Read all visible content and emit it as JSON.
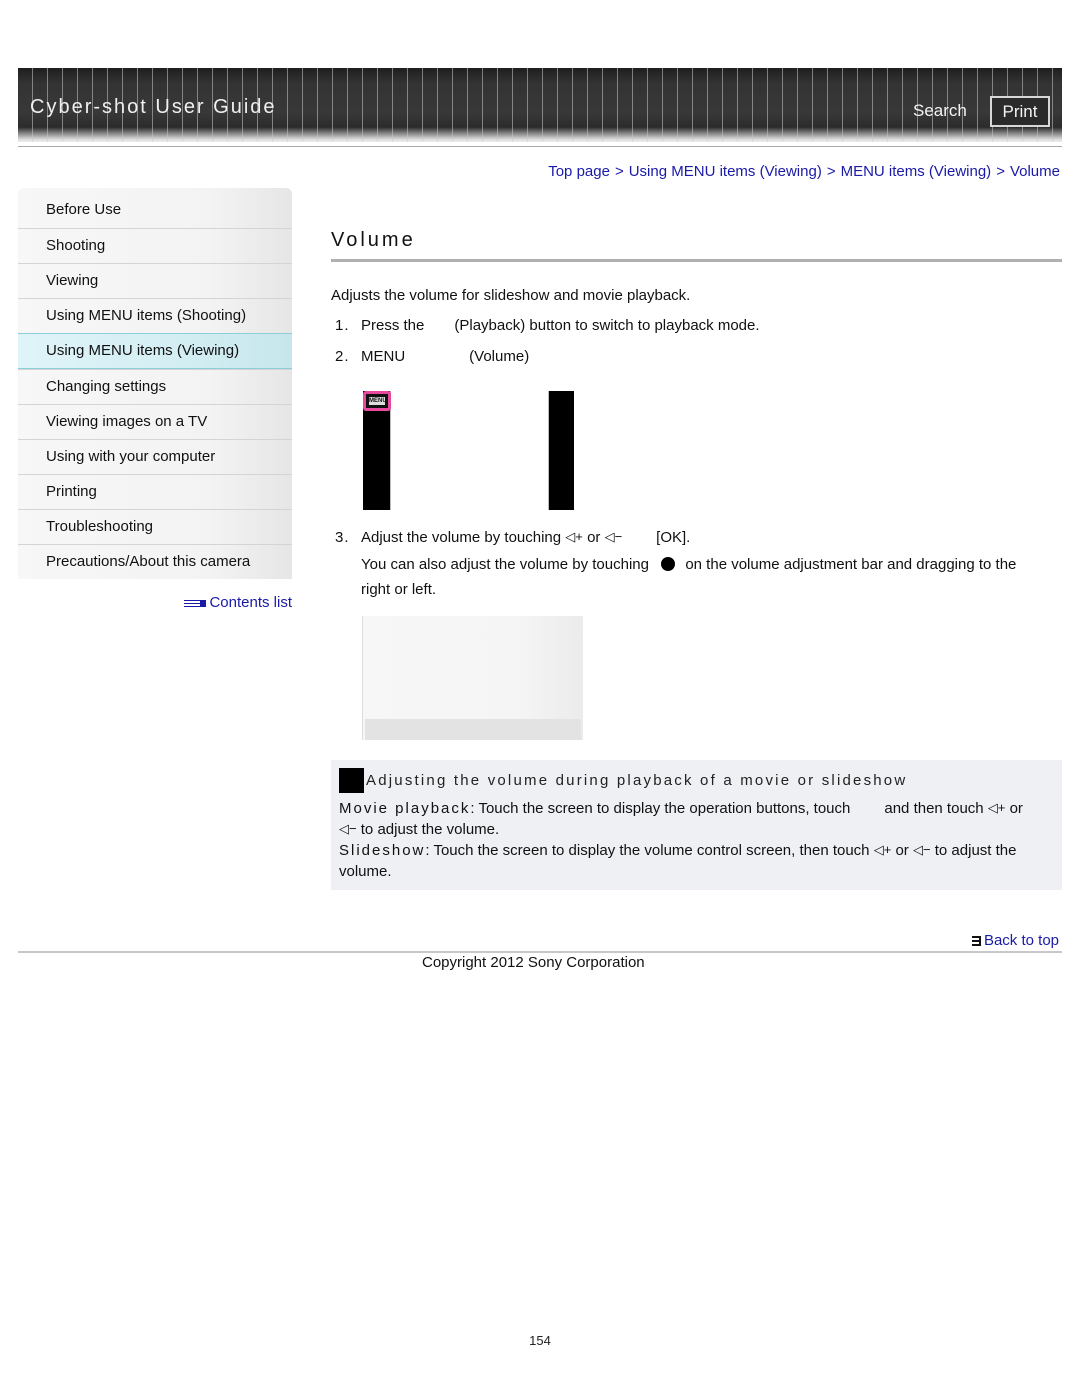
{
  "header": {
    "title": "Cyber-shot User Guide",
    "search_label": "Search",
    "print_label": "Print"
  },
  "sidebar": {
    "items": [
      {
        "label": "Before Use",
        "active": false
      },
      {
        "label": "Shooting",
        "active": false
      },
      {
        "label": "Viewing",
        "active": false
      },
      {
        "label": "Using MENU items (Shooting)",
        "active": false
      },
      {
        "label": "Using MENU items (Viewing)",
        "active": true
      },
      {
        "label": "Changing settings",
        "active": false
      },
      {
        "label": "Viewing images on a TV",
        "active": false
      },
      {
        "label": "Using with your computer",
        "active": false
      },
      {
        "label": "Printing",
        "active": false
      },
      {
        "label": "Troubleshooting",
        "active": false
      },
      {
        "label": "Precautions/About this camera",
        "active": false
      }
    ],
    "contents_link": "Contents list"
  },
  "breadcrumb": {
    "items": [
      "Top page",
      "Using MENU items (Viewing)",
      "MENU items (Viewing)",
      "Volume"
    ],
    "separator": ">"
  },
  "main": {
    "title": "Volume",
    "intro": "Adjusts the volume for slideshow and movie playback.",
    "steps": [
      {
        "num": "1.",
        "text_before": "Press the",
        "text_after": "(Playback) button to switch to playback mode."
      },
      {
        "num": "2.",
        "text_before": "MENU",
        "text_after": "(Volume)"
      },
      {
        "num": "3.",
        "text_before": "Adjust the volume by touching",
        "or": "or",
        "text_after": "[OK]."
      }
    ],
    "step3_note_a": "You can also adjust the volume by touching",
    "step3_note_b": "on the volume adjustment bar and dragging to the",
    "step3_note_c": "right or left.",
    "screen_menu_label": "MENU"
  },
  "note": {
    "title": "Adjusting the volume during playback of a movie or slideshow",
    "movie_label": "Movie playback",
    "movie_text_a": ": Touch the screen to display the operation buttons, touch",
    "movie_text_b": "and then touch",
    "movie_text_c": "or",
    "movie_text_d": "to adjust the volume.",
    "slideshow_label": "Slideshow",
    "slideshow_text_a": ": Touch the screen to display the volume control screen, then touch",
    "slideshow_text_b": "or",
    "slideshow_text_c": "to adjust the",
    "slideshow_text_d": "volume."
  },
  "icons": {
    "vol_up": "🔈+",
    "vol_down": "🔈-",
    "contents": "contents-list-icon",
    "back": "back-to-top-icon"
  },
  "footer": {
    "back_to_top": "Back to top",
    "copyright": "Copyright 2012 Sony Corporation",
    "page_number": "154"
  },
  "colors": {
    "link": "#1a1aa8",
    "active_nav": "#d3eef3",
    "highlight": "#e8489e",
    "note_bg": "#eef0f4"
  }
}
